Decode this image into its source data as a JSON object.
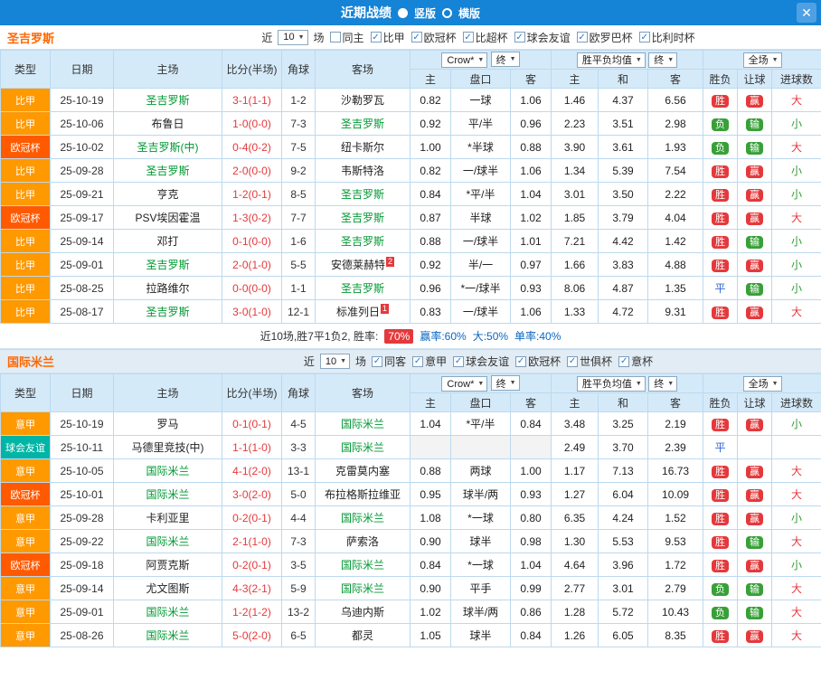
{
  "header": {
    "title": "近期战绩",
    "radios": [
      {
        "label": "竖版",
        "selected": false
      },
      {
        "label": "横版",
        "selected": true
      }
    ],
    "close_icon": "✕"
  },
  "colors": {
    "topbar": "#1583d6",
    "focus_team": "#009933",
    "score": "#e4393c",
    "section_title": "#ff6600",
    "stat_blue": "#0a66c2"
  },
  "type_colors": {
    "比甲": "#ff9900",
    "意甲": "#ff9900",
    "欧冠杯": "#ff5a00",
    "球会友谊": "#00b5a5"
  },
  "result_styles": {
    "胜": "pill-red",
    "负": "pill-green",
    "平": "text-blue",
    "赢": "pill-red",
    "输": "pill-green",
    "大": "text-red",
    "小": "text-green"
  },
  "sections": [
    {
      "team": "圣吉罗斯",
      "filters": {
        "near": "近",
        "count": "10",
        "matches": "场",
        "checkboxes": [
          {
            "label": "同主",
            "checked": false
          },
          {
            "label": "比甲",
            "checked": true
          },
          {
            "label": "欧冠杯",
            "checked": true
          },
          {
            "label": "比超杯",
            "checked": true
          },
          {
            "label": "球会友谊",
            "checked": true
          },
          {
            "label": "欧罗巴杯",
            "checked": true
          },
          {
            "label": "比利时杯",
            "checked": true
          }
        ]
      },
      "table": {
        "columns": [
          "类型",
          "日期",
          "主场",
          "比分(半场)",
          "角球",
          "客场"
        ],
        "odds_select": "Crow*",
        "odds_final": "终",
        "odds_sub": [
          "主",
          "盘口",
          "客"
        ],
        "avg_select": "胜平负均值",
        "avg_final": "终",
        "avg_sub": [
          "主",
          "和",
          "客"
        ],
        "full_select": "全场",
        "full_sub": [
          "胜负",
          "让球",
          "进球数"
        ],
        "rows": [
          {
            "league": "比甲",
            "date": "25-10-19",
            "home": "圣吉罗斯",
            "home_focus": true,
            "home_rank": "",
            "score": "3-1(1-1)",
            "corner": "1-2",
            "away": "沙勒罗瓦",
            "away_focus": false,
            "away_rank": "",
            "odds": [
              "0.82",
              "一球",
              "1.06"
            ],
            "avg": [
              "1.46",
              "4.37",
              "6.56"
            ],
            "result": "胜",
            "let": "赢",
            "goal": "大"
          },
          {
            "league": "比甲",
            "date": "25-10-06",
            "home": "布鲁日",
            "home_focus": false,
            "home_rank": "",
            "score": "1-0(0-0)",
            "corner": "7-3",
            "away": "圣吉罗斯",
            "away_focus": true,
            "away_rank": "",
            "odds": [
              "0.92",
              "平/半",
              "0.96"
            ],
            "avg": [
              "2.23",
              "3.51",
              "2.98"
            ],
            "result": "负",
            "let": "输",
            "goal": "小"
          },
          {
            "league": "欧冠杯",
            "date": "25-10-02",
            "home": "圣吉罗斯(中)",
            "home_focus": true,
            "home_rank": "",
            "score": "0-4(0-2)",
            "corner": "7-5",
            "away": "纽卡斯尔",
            "away_focus": false,
            "away_rank": "",
            "odds": [
              "1.00",
              "*半球",
              "0.88"
            ],
            "avg": [
              "3.90",
              "3.61",
              "1.93"
            ],
            "result": "负",
            "let": "输",
            "goal": "大"
          },
          {
            "league": "比甲",
            "date": "25-09-28",
            "home": "圣吉罗斯",
            "home_focus": true,
            "home_rank": "",
            "score": "2-0(0-0)",
            "corner": "9-2",
            "away": "韦斯特洛",
            "away_focus": false,
            "away_rank": "",
            "odds": [
              "0.82",
              "一/球半",
              "1.06"
            ],
            "avg": [
              "1.34",
              "5.39",
              "7.54"
            ],
            "result": "胜",
            "let": "赢",
            "goal": "小"
          },
          {
            "league": "比甲",
            "date": "25-09-21",
            "home": "亨克",
            "home_focus": false,
            "home_rank": "",
            "score": "1-2(0-1)",
            "corner": "8-5",
            "away": "圣吉罗斯",
            "away_focus": true,
            "away_rank": "",
            "odds": [
              "0.84",
              "*平/半",
              "1.04"
            ],
            "avg": [
              "3.01",
              "3.50",
              "2.22"
            ],
            "result": "胜",
            "let": "赢",
            "goal": "小"
          },
          {
            "league": "欧冠杯",
            "date": "25-09-17",
            "home": "PSV埃因霍温",
            "home_focus": false,
            "home_rank": "",
            "score": "1-3(0-2)",
            "corner": "7-7",
            "away": "圣吉罗斯",
            "away_focus": true,
            "away_rank": "",
            "odds": [
              "0.87",
              "半球",
              "1.02"
            ],
            "avg": [
              "1.85",
              "3.79",
              "4.04"
            ],
            "result": "胜",
            "let": "赢",
            "goal": "大"
          },
          {
            "league": "比甲",
            "date": "25-09-14",
            "home": "邓打",
            "home_focus": false,
            "home_rank": "",
            "score": "0-1(0-0)",
            "corner": "1-6",
            "away": "圣吉罗斯",
            "away_focus": true,
            "away_rank": "",
            "odds": [
              "0.88",
              "一/球半",
              "1.01"
            ],
            "avg": [
              "7.21",
              "4.42",
              "1.42"
            ],
            "result": "胜",
            "let": "输",
            "goal": "小"
          },
          {
            "league": "比甲",
            "date": "25-09-01",
            "home": "圣吉罗斯",
            "home_focus": true,
            "home_rank": "",
            "score": "2-0(1-0)",
            "corner": "5-5",
            "away": "安德莱赫特",
            "away_focus": false,
            "away_rank": "2",
            "odds": [
              "0.92",
              "半/一",
              "0.97"
            ],
            "avg": [
              "1.66",
              "3.83",
              "4.88"
            ],
            "result": "胜",
            "let": "赢",
            "goal": "小"
          },
          {
            "league": "比甲",
            "date": "25-08-25",
            "home": "拉路维尔",
            "home_focus": false,
            "home_rank": "",
            "score": "0-0(0-0)",
            "corner": "1-1",
            "away": "圣吉罗斯",
            "away_focus": true,
            "away_rank": "",
            "odds": [
              "0.96",
              "*一/球半",
              "0.93"
            ],
            "avg": [
              "8.06",
              "4.87",
              "1.35"
            ],
            "result": "平",
            "let": "输",
            "goal": "小"
          },
          {
            "league": "比甲",
            "date": "25-08-17",
            "home": "圣吉罗斯",
            "home_focus": true,
            "home_rank": "",
            "score": "3-0(1-0)",
            "corner": "12-1",
            "away": "标准列日",
            "away_focus": false,
            "away_rank": "1",
            "odds": [
              "0.83",
              "一/球半",
              "1.06"
            ],
            "avg": [
              "1.33",
              "4.72",
              "9.31"
            ],
            "result": "胜",
            "let": "赢",
            "goal": "大"
          }
        ]
      },
      "summary": {
        "prefix": "近10场,胜7平1负2, 胜率:",
        "win_rate": "70%",
        "stats": [
          "赢率:60%",
          "大:50%",
          "单率:40%"
        ]
      }
    },
    {
      "team": "国际米兰",
      "filters": {
        "near": "近",
        "count": "10",
        "matches": "场",
        "checkboxes": [
          {
            "label": "同客",
            "checked": true
          },
          {
            "label": "意甲",
            "checked": true
          },
          {
            "label": "球会友谊",
            "checked": true
          },
          {
            "label": "欧冠杯",
            "checked": true
          },
          {
            "label": "世俱杯",
            "checked": true
          },
          {
            "label": "意杯",
            "checked": true
          }
        ]
      },
      "table": {
        "columns": [
          "类型",
          "日期",
          "主场",
          "比分(半场)",
          "角球",
          "客场"
        ],
        "odds_select": "Crow*",
        "odds_final": "终",
        "odds_sub": [
          "主",
          "盘口",
          "客"
        ],
        "avg_select": "胜平负均值",
        "avg_final": "终",
        "avg_sub": [
          "主",
          "和",
          "客"
        ],
        "full_select": "全场",
        "full_sub": [
          "胜负",
          "让球",
          "进球数"
        ],
        "rows": [
          {
            "league": "意甲",
            "date": "25-10-19",
            "home": "罗马",
            "home_focus": false,
            "home_rank": "",
            "score": "0-1(0-1)",
            "corner": "4-5",
            "away": "国际米兰",
            "away_focus": true,
            "away_rank": "",
            "odds": [
              "1.04",
              "*平/半",
              "0.84"
            ],
            "avg": [
              "3.48",
              "3.25",
              "2.19"
            ],
            "result": "胜",
            "let": "赢",
            "goal": "小"
          },
          {
            "league": "球会友谊",
            "date": "25-10-11",
            "home": "马德里竞技(中)",
            "home_focus": false,
            "home_rank": "",
            "score": "1-1(1-0)",
            "corner": "3-3",
            "away": "国际米兰",
            "away_focus": true,
            "away_rank": "",
            "odds": [
              "",
              "",
              ""
            ],
            "avg": [
              "2.49",
              "3.70",
              "2.39"
            ],
            "result": "平",
            "let": "",
            "goal": ""
          },
          {
            "league": "意甲",
            "date": "25-10-05",
            "home": "国际米兰",
            "home_focus": true,
            "home_rank": "",
            "score": "4-1(2-0)",
            "corner": "13-1",
            "away": "克雷莫内塞",
            "away_focus": false,
            "away_rank": "",
            "odds": [
              "0.88",
              "两球",
              "1.00"
            ],
            "avg": [
              "1.17",
              "7.13",
              "16.73"
            ],
            "result": "胜",
            "let": "赢",
            "goal": "大"
          },
          {
            "league": "欧冠杯",
            "date": "25-10-01",
            "home": "国际米兰",
            "home_focus": true,
            "home_rank": "",
            "score": "3-0(2-0)",
            "corner": "5-0",
            "away": "布拉格斯拉维亚",
            "away_focus": false,
            "away_rank": "",
            "odds": [
              "0.95",
              "球半/两",
              "0.93"
            ],
            "avg": [
              "1.27",
              "6.04",
              "10.09"
            ],
            "result": "胜",
            "let": "赢",
            "goal": "大"
          },
          {
            "league": "意甲",
            "date": "25-09-28",
            "home": "卡利亚里",
            "home_focus": false,
            "home_rank": "",
            "score": "0-2(0-1)",
            "corner": "4-4",
            "away": "国际米兰",
            "away_focus": true,
            "away_rank": "",
            "odds": [
              "1.08",
              "*一球",
              "0.80"
            ],
            "avg": [
              "6.35",
              "4.24",
              "1.52"
            ],
            "result": "胜",
            "let": "赢",
            "goal": "小"
          },
          {
            "league": "意甲",
            "date": "25-09-22",
            "home": "国际米兰",
            "home_focus": true,
            "home_rank": "",
            "score": "2-1(1-0)",
            "corner": "7-3",
            "away": "萨索洛",
            "away_focus": false,
            "away_rank": "",
            "odds": [
              "0.90",
              "球半",
              "0.98"
            ],
            "avg": [
              "1.30",
              "5.53",
              "9.53"
            ],
            "result": "胜",
            "let": "输",
            "goal": "大"
          },
          {
            "league": "欧冠杯",
            "date": "25-09-18",
            "home": "阿贾克斯",
            "home_focus": false,
            "home_rank": "",
            "score": "0-2(0-1)",
            "corner": "3-5",
            "away": "国际米兰",
            "away_focus": true,
            "away_rank": "",
            "odds": [
              "0.84",
              "*一球",
              "1.04"
            ],
            "avg": [
              "4.64",
              "3.96",
              "1.72"
            ],
            "result": "胜",
            "let": "赢",
            "goal": "小"
          },
          {
            "league": "意甲",
            "date": "25-09-14",
            "home": "尤文图斯",
            "home_focus": false,
            "home_rank": "",
            "score": "4-3(2-1)",
            "corner": "5-9",
            "away": "国际米兰",
            "away_focus": true,
            "away_rank": "",
            "odds": [
              "0.90",
              "平手",
              "0.99"
            ],
            "avg": [
              "2.77",
              "3.01",
              "2.79"
            ],
            "result": "负",
            "let": "输",
            "goal": "大"
          },
          {
            "league": "意甲",
            "date": "25-09-01",
            "home": "国际米兰",
            "home_focus": true,
            "home_rank": "",
            "score": "1-2(1-2)",
            "corner": "13-2",
            "away": "乌迪内斯",
            "away_focus": false,
            "away_rank": "",
            "odds": [
              "1.02",
              "球半/两",
              "0.86"
            ],
            "avg": [
              "1.28",
              "5.72",
              "10.43"
            ],
            "result": "负",
            "let": "输",
            "goal": "大"
          },
          {
            "league": "意甲",
            "date": "25-08-26",
            "home": "国际米兰",
            "home_focus": true,
            "home_rank": "",
            "score": "5-0(2-0)",
            "corner": "6-5",
            "away": "都灵",
            "away_focus": false,
            "away_rank": "",
            "odds": [
              "1.05",
              "球半",
              "0.84"
            ],
            "avg": [
              "1.26",
              "6.05",
              "8.35"
            ],
            "result": "胜",
            "let": "赢",
            "goal": "大"
          }
        ]
      }
    }
  ]
}
